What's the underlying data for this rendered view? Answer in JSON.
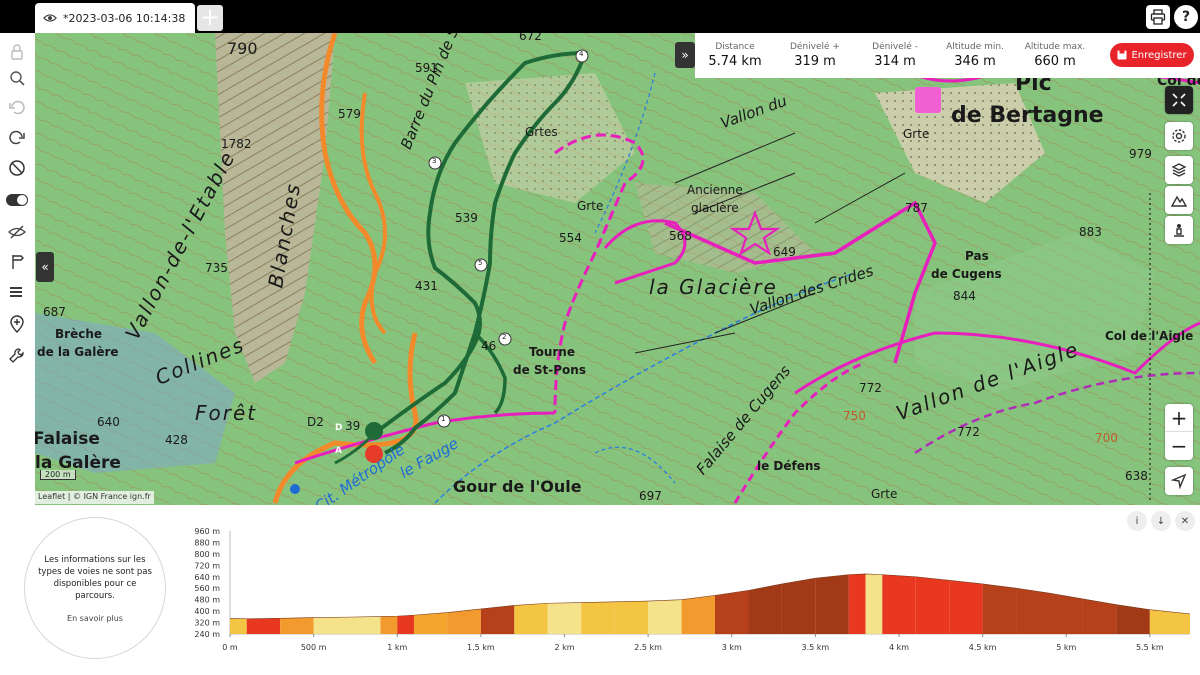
{
  "tab": {
    "title": "*2023-03-06 10:14:38",
    "new_tab": "+"
  },
  "top_actions": {
    "help": "?"
  },
  "stats": [
    {
      "label": "Distance",
      "value": "5.74 km"
    },
    {
      "label": "Dénivelé +",
      "value": "319 m"
    },
    {
      "label": "Dénivelé -",
      "value": "314 m"
    },
    {
      "label": "Altitude min.",
      "value": "346 m"
    },
    {
      "label": "Altitude max.",
      "value": "660 m"
    }
  ],
  "save_button": "Enregistrer",
  "collapse_stats": "»",
  "collapse_left": "«",
  "zoom": {
    "in": "+",
    "out": "−"
  },
  "attribution": "Leaflet | © IGN France ign.fr",
  "scale": "200 m",
  "map_labels": [
    {
      "text": "790",
      "cls": "ml-small"
    },
    {
      "text": "672",
      "cls": "ml-small"
    },
    {
      "text": "591",
      "cls": "ml-small"
    },
    {
      "text": "579",
      "cls": "ml-small"
    },
    {
      "text": "1782",
      "cls": "ml-small"
    },
    {
      "text": "Blanches",
      "cls": "ml-big"
    },
    {
      "text": "Vallon-de-l'Etable",
      "cls": "ml-big"
    },
    {
      "text": "735",
      "cls": "ml-small"
    },
    {
      "text": "687",
      "cls": "ml-small"
    },
    {
      "text": "Brèche",
      "cls": "ml-bold"
    },
    {
      "text": "de la Galère",
      "cls": "ml-bold"
    },
    {
      "text": "Collines",
      "cls": "ml-big"
    },
    {
      "text": "Forêt",
      "cls": "ml-big"
    },
    {
      "text": "D2",
      "cls": "ml-small"
    },
    {
      "text": "39",
      "cls": "ml-small"
    },
    {
      "text": "640",
      "cls": "ml-small"
    },
    {
      "text": "428",
      "cls": "ml-small"
    },
    {
      "text": "Falaise",
      "cls": "ml-huge"
    },
    {
      "text": "la Galère",
      "cls": "ml-huge"
    },
    {
      "text": "Barre du Pin de Simon",
      "cls": "ml-med"
    },
    {
      "text": "Grtes",
      "cls": "ml-small"
    },
    {
      "text": "539",
      "cls": "ml-small"
    },
    {
      "text": "431",
      "cls": "ml-small"
    },
    {
      "text": "46",
      "cls": "ml-small"
    },
    {
      "text": "Tourne",
      "cls": "ml-bold"
    },
    {
      "text": "de St-Pons",
      "cls": "ml-bold"
    },
    {
      "text": "Grte",
      "cls": "ml-small"
    },
    {
      "text": "554",
      "cls": "ml-small"
    },
    {
      "text": "568",
      "cls": "ml-small"
    },
    {
      "text": "Ancienne",
      "cls": "ml-small"
    },
    {
      "text": "glacière",
      "cls": "ml-small"
    },
    {
      "text": "649",
      "cls": "ml-small"
    },
    {
      "text": "la Glacière",
      "cls": "ml-big"
    },
    {
      "text": "Vallon des Crides",
      "cls": "ml-med"
    },
    {
      "text": "Vallon du",
      "cls": "ml-med"
    },
    {
      "text": "Gour de l'Oule",
      "cls": "ml-huge"
    },
    {
      "text": "le Fauge",
      "cls": "ml-water"
    },
    {
      "text": "Cit. Métropole",
      "cls": "ml-water"
    },
    {
      "text": "697",
      "cls": "ml-small"
    },
    {
      "text": "Falaise de Cugens",
      "cls": "ml-med"
    },
    {
      "text": "772",
      "cls": "ml-small"
    },
    {
      "text": "750",
      "cls": "ml-small"
    },
    {
      "text": "le Défens",
      "cls": "ml-bold"
    },
    {
      "text": "Grte",
      "cls": "ml-small"
    },
    {
      "text": "Pic",
      "cls": "ml-huge"
    },
    {
      "text": "de Bertagne",
      "cls": "ml-huge"
    },
    {
      "text": "Col de",
      "cls": "ml-bold"
    },
    {
      "text": "Grte",
      "cls": "ml-small"
    },
    {
      "text": "979",
      "cls": "ml-small"
    },
    {
      "text": "787",
      "cls": "ml-small"
    },
    {
      "text": "883",
      "cls": "ml-small"
    },
    {
      "text": "Pas",
      "cls": "ml-bold"
    },
    {
      "text": "de Cugens",
      "cls": "ml-bold"
    },
    {
      "text": "844",
      "cls": "ml-small"
    },
    {
      "text": "Col de l'Aigle",
      "cls": "ml-bold"
    },
    {
      "text": "Vallon de l'Aigle",
      "cls": "ml-big"
    },
    {
      "text": "772",
      "cls": "ml-small"
    },
    {
      "text": "700",
      "cls": "ml-small"
    },
    {
      "text": "638",
      "cls": "ml-small"
    }
  ],
  "markers": {
    "start": "D",
    "end": "A",
    "km": [
      "1",
      "2",
      "3",
      "4",
      "5"
    ]
  },
  "profile": {
    "info_message": "Les informations sur les types de voies ne sont pas disponibles pour ce parcours.",
    "learn_more": "En savoir plus",
    "buttons": {
      "info": "i",
      "download": "↓",
      "close": "✕"
    }
  },
  "chart_data": {
    "type": "area",
    "ylabel": "",
    "xlabel": "",
    "y_ticks": [
      "240 m",
      "320 m",
      "400 m",
      "480 m",
      "560 m",
      "640 m",
      "720 m",
      "800 m",
      "880 m",
      "960 m"
    ],
    "x_ticks": [
      "0 m",
      "500 m",
      "1 km",
      "1.5 km",
      "2 km",
      "2.5 km",
      "3 km",
      "3.5 km",
      "4 km",
      "4.5 km",
      "5 km",
      "5.5 km"
    ],
    "ylim": [
      240,
      960
    ],
    "xlim": [
      0,
      5.74
    ],
    "x_km": [
      0,
      0.1,
      0.3,
      0.5,
      0.7,
      0.9,
      1.0,
      1.1,
      1.3,
      1.5,
      1.7,
      1.9,
      2.1,
      2.3,
      2.5,
      2.7,
      2.9,
      3.1,
      3.3,
      3.5,
      3.7,
      3.8,
      3.9,
      4.1,
      4.3,
      4.5,
      4.7,
      4.9,
      5.1,
      5.3,
      5.5,
      5.74
    ],
    "elevation_m": [
      350,
      346,
      350,
      355,
      358,
      362,
      365,
      372,
      390,
      415,
      440,
      455,
      460,
      465,
      470,
      480,
      510,
      545,
      590,
      630,
      655,
      660,
      655,
      640,
      615,
      590,
      560,
      525,
      485,
      445,
      410,
      380
    ],
    "slope_colors": [
      "#f4c542",
      "#e8381f",
      "#f29a2e",
      "#f4e38a",
      "#f4e38a",
      "#f29a2e",
      "#e8381f",
      "#f4a52e",
      "#f29a2e",
      "#b5401a",
      "#f4c542",
      "#f4e38a",
      "#f4c542",
      "#f4c542",
      "#f4e38a",
      "#f29a2e",
      "#b5401a",
      "#a33a17",
      "#a33a17",
      "#a33a17",
      "#e8381f",
      "#f4e38a",
      "#e8381f",
      "#e8381f",
      "#e8381f",
      "#b5401a",
      "#b5401a",
      "#b5401a",
      "#b5401a",
      "#a33a17",
      "#f4c542",
      "#f4c542"
    ]
  }
}
